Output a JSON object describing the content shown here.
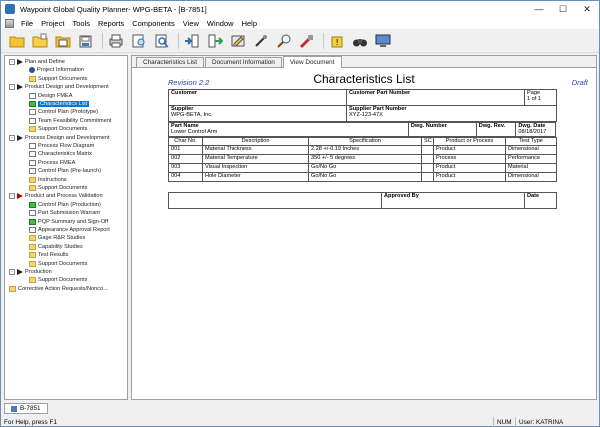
{
  "window": {
    "title": "Waypoint Global Quality Planner- WPG-BETA - [B-7851]"
  },
  "menu": [
    "File",
    "Project",
    "Tools",
    "Reports",
    "Components",
    "View",
    "Window",
    "Help"
  ],
  "toolbar": {
    "buttons": [
      "open-folder-icon",
      "new-folder-icon",
      "save-icon",
      "save-all-icon",
      "print-icon",
      "print-preview-icon",
      "find-icon",
      "import-icon",
      "export-icon",
      "edit-icon",
      "link-icon",
      "search-icon",
      "tools-icon",
      "warning-icon",
      "binoculars-icon",
      "monitor-icon"
    ]
  },
  "tree": [
    {
      "label": "Plan and Define",
      "level": 0,
      "icon": "arrow",
      "toggle": "-"
    },
    {
      "label": "Project Information",
      "level": 1,
      "icon": "info"
    },
    {
      "label": "Support Documents",
      "level": 1,
      "icon": "folder"
    },
    {
      "label": "Product Design and Development",
      "level": 0,
      "icon": "arrow",
      "toggle": "-"
    },
    {
      "label": "Design FMEA",
      "level": 1,
      "icon": "doc"
    },
    {
      "label": "Characteristics List",
      "level": 1,
      "icon": "green",
      "selected": true
    },
    {
      "label": "Control Plan (Prototype)",
      "level": 1,
      "icon": "doc"
    },
    {
      "label": "Team Feasibility Commitment",
      "level": 1,
      "icon": "doc"
    },
    {
      "label": "Support Documents",
      "level": 1,
      "icon": "folder"
    },
    {
      "label": "Process Design and Development",
      "level": 0,
      "icon": "arrow",
      "toggle": "-"
    },
    {
      "label": "Process Flow Diagram",
      "level": 1,
      "icon": "doc"
    },
    {
      "label": "Characteristics Matrix",
      "level": 1,
      "icon": "doc"
    },
    {
      "label": "Process FMEA",
      "level": 1,
      "icon": "doc"
    },
    {
      "label": "Control Plan (Pre-launch)",
      "level": 1,
      "icon": "doc"
    },
    {
      "label": "Instructions",
      "level": 1,
      "icon": "folder"
    },
    {
      "label": "Support Documents",
      "level": 1,
      "icon": "folder"
    },
    {
      "label": "Product and Process Validation",
      "level": 0,
      "icon": "arrowred",
      "toggle": "-"
    },
    {
      "label": "Control Plan (Production)",
      "level": 1,
      "icon": "green"
    },
    {
      "label": "Part Submission Warrant",
      "level": 1,
      "icon": "doc"
    },
    {
      "label": "PQP Summary and Sign-Off",
      "level": 1,
      "icon": "green"
    },
    {
      "label": "Appearance Approval Report",
      "level": 1,
      "icon": "doc"
    },
    {
      "label": "Gage R&R Studies",
      "level": 1,
      "icon": "folder"
    },
    {
      "label": "Capability Studies",
      "level": 1,
      "icon": "folder"
    },
    {
      "label": "Test Results",
      "level": 1,
      "icon": "folder"
    },
    {
      "label": "Support Documents",
      "level": 1,
      "icon": "folder"
    },
    {
      "label": "Production",
      "level": 0,
      "icon": "arrow",
      "toggle": "-"
    },
    {
      "label": "Support Documents",
      "level": 1,
      "icon": "folder"
    },
    {
      "label": "Corrective Action Requests/Nonco...",
      "level": 0,
      "icon": "folder"
    }
  ],
  "tabs": [
    "Characteristics List",
    "Document Information",
    "View Document"
  ],
  "document": {
    "revision": "Revision 2.2",
    "title": "Characteristics List",
    "status": "Draft",
    "customer_label": "Customer",
    "customer_value": "",
    "customer_part_label": "Customer Part Number",
    "customer_part_value": "",
    "page_label": "Page",
    "page_value": "1 of 1",
    "supplier_label": "Supplier",
    "supplier_value": "WPG-BETA, Inc.",
    "supplier_part_label": "Supplier Part Number",
    "supplier_part_value": "XYZ-123-47X",
    "part_name_label": "Part Name",
    "part_name_value": "Lower Control Arm",
    "dwg_number_label": "Dwg. Number",
    "dwg_rev_label": "Dwg. Rev.",
    "dwg_date_label": "Dwg. Date",
    "dwg_date_value": "08/18/2017",
    "columns": [
      "Char No.",
      "Description",
      "Specification",
      "SC",
      "Product or Process",
      "Test Type"
    ],
    "rows": [
      [
        "001",
        "Material Thickness",
        "2.28 +/-0.19 Inches",
        "",
        "Product",
        "Dimensional"
      ],
      [
        "002",
        "Material Temperature",
        "350 +/- 5 degrees",
        "",
        "Process",
        "Performance"
      ],
      [
        "003",
        "Visual Inspection",
        "Go/No Go",
        "",
        "Product",
        "Material"
      ],
      [
        "004",
        "Hole Diameter",
        "Go/No Go",
        "",
        "Product",
        "Dimensional"
      ]
    ],
    "approved_by_label": "Approved By",
    "date_label": "Date"
  },
  "bottom_tab": "B-7851",
  "status": {
    "message": "For Help, press F1",
    "num": "NUM",
    "user": "User: KATRINA"
  }
}
